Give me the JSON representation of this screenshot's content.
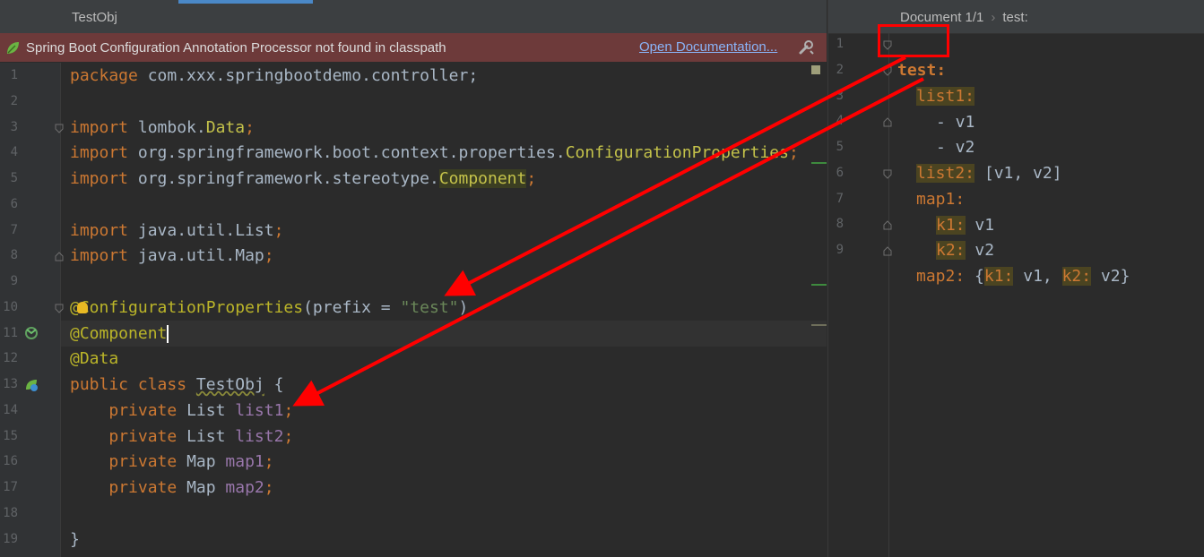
{
  "editor": {
    "tab_title": "TestObj",
    "banner": {
      "message": "Spring Boot Configuration Annotation Processor not found in classpath",
      "link": "Open Documentation..."
    },
    "line_numbers": [
      "1",
      "2",
      "3",
      "4",
      "5",
      "6",
      "7",
      "8",
      "9",
      "10",
      "11",
      "12",
      "13",
      "14",
      "15",
      "16",
      "17",
      "18",
      "19"
    ],
    "code": {
      "l1": {
        "kw": "package",
        "rest": " com.xxx.springbootdemo.controller;"
      },
      "l3": {
        "kw": "import",
        "pkg": " lombok.",
        "cls": "Data",
        "end": ";"
      },
      "l4": {
        "kw": "import",
        "pkg": " org.springframework.boot.context.properties.",
        "cls": "ConfigurationProperties",
        "end": ";"
      },
      "l5": {
        "kw": "import",
        "pkg": " org.springframework.stereotype.",
        "cls": "Component",
        "end": ";"
      },
      "l7": {
        "kw": "import",
        "pkg": " java.util.List",
        "end": ";"
      },
      "l8": {
        "kw": "import",
        "pkg": " java.util.Map",
        "end": ";"
      },
      "l10": {
        "at": "@",
        "ann": "ConfigurationProperties",
        "open": "(prefix = ",
        "str": "\"test\"",
        "close": ")"
      },
      "l11": {
        "ann": "@Component"
      },
      "l12": {
        "ann": "@Data"
      },
      "l13": {
        "kw": "public class ",
        "name": "TestObj",
        "rest": " {"
      },
      "l14": {
        "kw": "private ",
        "type": "List ",
        "field": "list1",
        "end": ";"
      },
      "l15": {
        "kw": "private ",
        "type": "List ",
        "field": "list2",
        "end": ";"
      },
      "l16": {
        "kw": "private ",
        "type": "Map ",
        "field": "map1",
        "end": ";"
      },
      "l17": {
        "kw": "private ",
        "type": "Map ",
        "field": "map2",
        "end": ";"
      },
      "l19": {
        "rest": "}"
      }
    }
  },
  "yaml": {
    "breadcrumb": [
      "Document 1/1",
      "test:"
    ],
    "line_numbers": [
      "1",
      "2",
      "3",
      "4",
      "5",
      "6",
      "7",
      "8",
      "9"
    ],
    "lines": {
      "y1": {
        "key": "test:"
      },
      "y2": {
        "key": "list1:"
      },
      "y3": {
        "val": "- v1"
      },
      "y4": {
        "val": "- v2"
      },
      "y5": {
        "key": "list2:",
        "val": " [v1, v2]"
      },
      "y6": {
        "key": "map1:"
      },
      "y7": {
        "key": "k1:",
        "val": " v1"
      },
      "y8": {
        "key": "k2:",
        "val": " v2"
      },
      "y9": {
        "key": "map2:",
        "val1": " {",
        "k1": "k1:",
        "v1": " v1, ",
        "k2": "k2:",
        "v2": " v2}"
      }
    }
  },
  "colors": {
    "background": "#2b2b2b",
    "keyword": "#cc7832",
    "annotation": "#bbb529",
    "string": "#6a8759",
    "field": "#9876aa",
    "banner": "#6d3a3a",
    "arrow": "#ff0000"
  }
}
